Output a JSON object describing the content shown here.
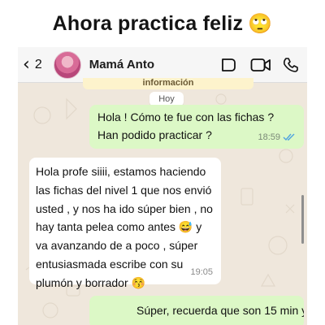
{
  "caption": {
    "title": "Ahora practica feliz",
    "emoji": "🙄"
  },
  "header": {
    "back_count": "2",
    "contact_name": "Mamá Anto",
    "icons": [
      "back-chevron-icon",
      "video-icon",
      "camera-icon",
      "phone-icon"
    ]
  },
  "chat": {
    "banner": "información",
    "day_label": "Hoy",
    "messages": [
      {
        "direction": "outgoing",
        "lines": [
          "Hola ! Cómo te fue con las fichas ?",
          "Han podido practicar ?"
        ],
        "time": "18:59",
        "status": "read"
      },
      {
        "direction": "incoming",
        "lines": [
          "Hola profe siiii, estamos haciendo",
          "las fichas del nivel 1 que nos envió",
          "usted , y nos ha ido súper bien , no",
          "hay tanta pelea como antes 😅 y",
          "va avanzando de a poco , súper",
          "entusiasmada escribe con su",
          "plumón y borrador 😚"
        ],
        "time": "19:05"
      },
      {
        "direction": "outgoing",
        "lines": [
          "Súper, recuerda que son 15 min y"
        ]
      }
    ]
  },
  "colors": {
    "outgoing_bubble": "#dcf8c6",
    "incoming_bubble": "#ffffff",
    "chat_background": "#efe7dc",
    "read_ticks": "#4fa3e0"
  }
}
